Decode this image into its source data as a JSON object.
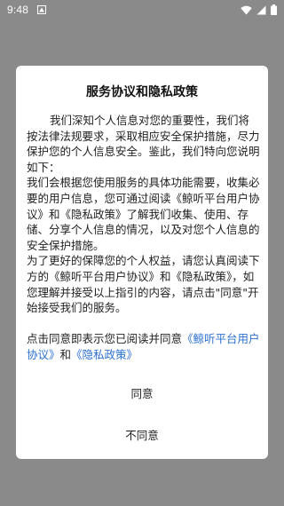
{
  "status_bar": {
    "time": "9:48",
    "icons": [
      "app-notification-icon",
      "wifi-icon",
      "cellular-signal-icon",
      "battery-icon"
    ]
  },
  "dialog": {
    "title": "服务协议和隐私政策",
    "paragraph1": "我们深知个人信息对您的重要性，我们将按法律法规要求，采取相应安全保护措施，尽力保护您的个人信息安全。鉴此，我们特向您说明如下：",
    "paragraph2": "我们会根据您使用服务的具体功能需要，收集必要的用户信息，您可通过阅读《鲸听平台用户协议》和《隐私政策》了解我们收集、使用、存储、分享个人信息的情况，以及对您个人信息的安全保护措施。",
    "paragraph3": "为了更好的保障您的个人权益，请您认真阅读下方的《鲸听平台用户协议》和《隐私政策》，如您理解并接受以上指引的内容，请点击\"同意\"开始接受我们的服务。",
    "consent_prefix": "点击同意即表示您已阅读并同意",
    "user_agreement_link": "《鲸听平台用户协议》",
    "consent_and": "和",
    "privacy_policy_link": "《隐私政策》",
    "agree_label": "同意",
    "disagree_label": "不同意"
  },
  "colors": {
    "overlay": "#8a8a8a",
    "link": "#2a6fd0",
    "dialog_bg": "#ffffff"
  }
}
